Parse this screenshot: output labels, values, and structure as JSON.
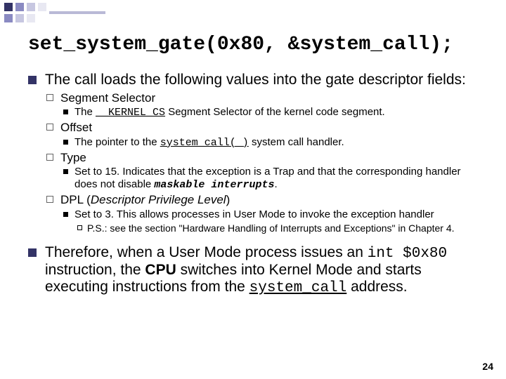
{
  "title_code": "set_system_gate(0x80, &system_call);",
  "p1_a": "The call loads the following values into the gate descriptor fields:",
  "seg": "Segment Selector",
  "seg_d_a": "The ",
  "seg_d_code": "__KERNEL_CS",
  "seg_d_b": " Segment Selector of the kernel code segment.",
  "off": "Offset",
  "off_d_a": "The pointer to the ",
  "off_d_code": "system_call( )",
  "off_d_b": " system call handler.",
  "typ": "Type",
  "typ_d_a": "Set to 15. Indicates that the exception is a Trap and that the corresponding handler does not disable ",
  "typ_d_code": "maskable interrupts",
  "typ_d_b": ".",
  "dpl_a": "DPL ",
  "dpl_b": "(",
  "dpl_c": "Descriptor Privilege Level",
  "dpl_d": ")",
  "dpl_d1": "Set to 3. This allows processes in User Mode to invoke the exception handler",
  "dpl_ps": "P.S.: see the section \"Hardware Handling of Interrupts and Exceptions\" in Chapter 4.",
  "p2_a": "Therefore, when a User Mode process issues an ",
  "p2_code1": "int $0x80",
  "p2_b": " instruction, the ",
  "p2_cpu": "CPU",
  "p2_c": " switches into Kernel Mode and starts executing instructions from the ",
  "p2_code2": "system_call",
  "p2_d": " address.",
  "page": "24"
}
